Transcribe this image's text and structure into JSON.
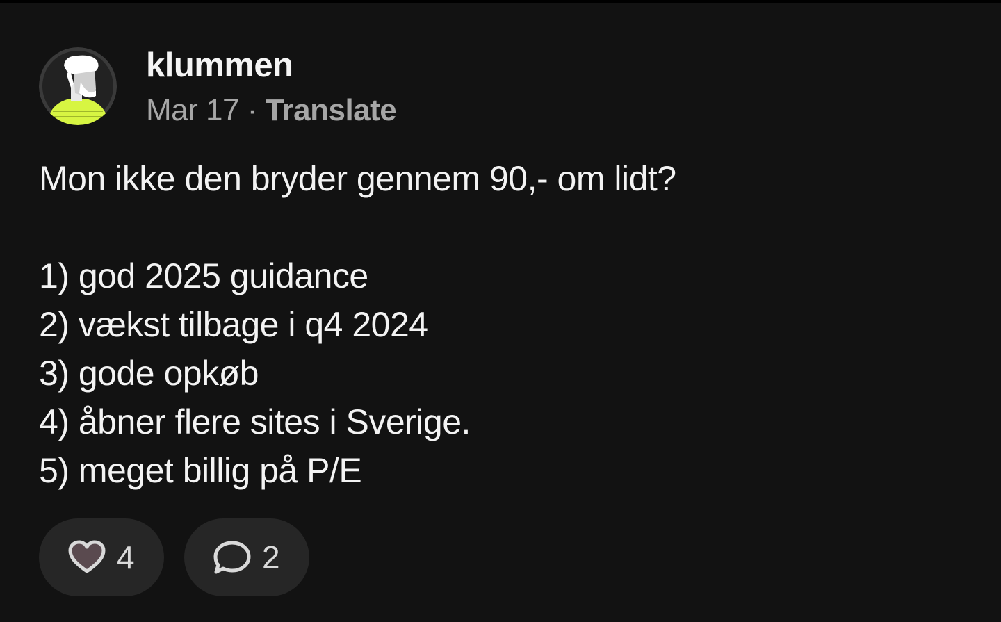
{
  "post": {
    "author": "klummen",
    "date": "Mar 17",
    "separator": " · ",
    "translate_label": "Translate",
    "lines": [
      "Mon ikke den bryder gennem 90,- om lidt?",
      "",
      "1) god 2025 guidance",
      "2) vækst tilbage i q4 2024",
      "3) gode opkøb",
      "4) åbner flere sites i Sverige.",
      "5) meget billig på P/E"
    ]
  },
  "actions": {
    "like_icon": "heart-icon",
    "like_count": "4",
    "reply_icon": "speech-bubble-icon",
    "reply_count": "2"
  },
  "colors": {
    "background": "#121212",
    "text": "#f3f3f3",
    "muted": "#a6a6a6",
    "pill": "#262626",
    "avatar_accent": "#d7f542"
  }
}
